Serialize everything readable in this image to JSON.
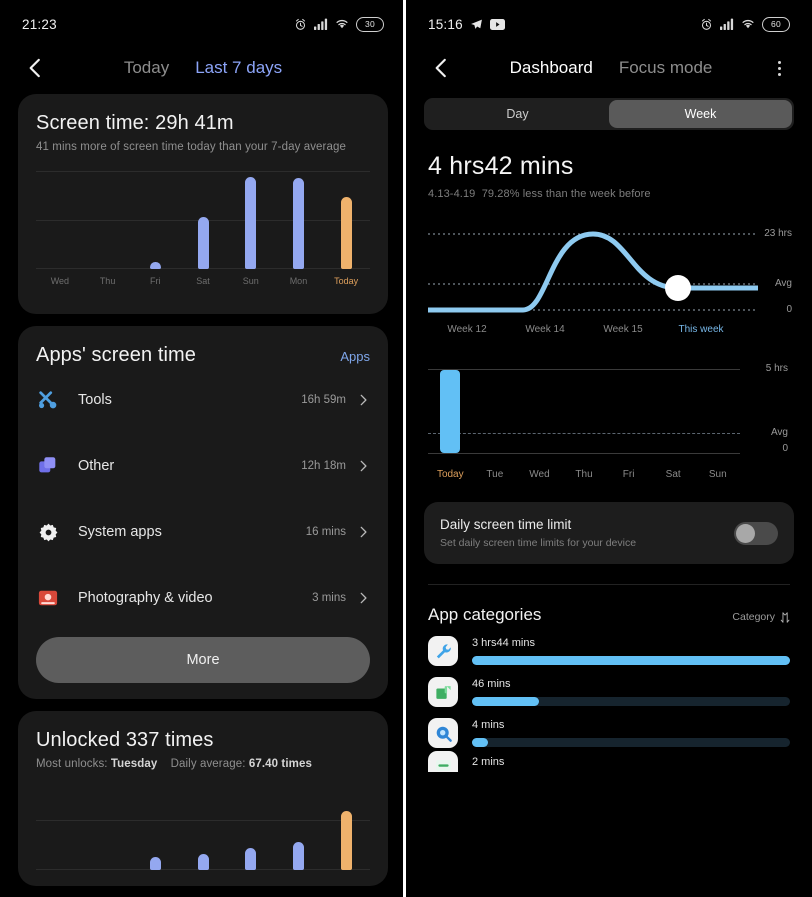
{
  "left": {
    "statusbar": {
      "time": "21:23",
      "battery": "30",
      "alarm_icon": "alarm-icon",
      "signal_icon": "signal-icon",
      "wifi_icon": "wifi-icon"
    },
    "nav": {
      "back_icon": "back-chevron-icon",
      "tab_today": "Today",
      "tab_last7": "Last 7 days"
    },
    "screen_time": {
      "title": "Screen time: 29h 41m",
      "subtitle": "41 mins more of screen time today than your 7-day average"
    },
    "apps": {
      "title": "Apps' screen time",
      "link": "Apps",
      "more": "More",
      "items": [
        {
          "icon": "tools-icon",
          "name": "Tools",
          "time": "16h 59m"
        },
        {
          "icon": "other-icon",
          "name": "Other",
          "time": "12h 18m"
        },
        {
          "icon": "gear-icon",
          "name": "System apps",
          "time": "16 mins"
        },
        {
          "icon": "camera-icon",
          "name": "Photography & video",
          "time": "3 mins"
        }
      ]
    },
    "unlocked": {
      "title": "Unlocked 337 times",
      "most_label": "Most unlocks:",
      "most_value": "Tuesday",
      "avg_label": "Daily average:",
      "avg_value": "67.40 times"
    }
  },
  "right": {
    "statusbar": {
      "time": "15:16",
      "battery": "60",
      "telegram_icon": "telegram-icon",
      "youtube_icon": "youtube-icon",
      "alarm_icon": "alarm-icon",
      "signal_icon": "signal-icon",
      "wifi_icon": "wifi-icon"
    },
    "nav": {
      "back_icon": "back-chevron-icon",
      "tab_dashboard": "Dashboard",
      "tab_focus": "Focus mode",
      "menu_icon": "kebab-menu-icon"
    },
    "segmented": {
      "day": "Day",
      "week": "Week",
      "selected": "Week"
    },
    "summary": {
      "hours": "4 hrs42 mins",
      "range": "4.13-4.19",
      "comparison": "79.28% less than the week before"
    },
    "limit": {
      "title": "Daily screen time limit",
      "subtitle": "Set daily screen time limits for your device",
      "toggle_state": "off"
    },
    "categories": {
      "title": "App categories",
      "sort_label": "Category",
      "sort_icon": "sort-icon",
      "items": [
        {
          "icon": "wrench-icon",
          "value": "3 hrs44 mins",
          "pct": 100
        },
        {
          "icon": "green-app-icon",
          "value": "46 mins",
          "pct": 21
        },
        {
          "icon": "search-icon",
          "value": "4 mins",
          "pct": 5
        },
        {
          "icon": "message-icon",
          "value": "2 mins",
          "pct": 3
        }
      ]
    }
  },
  "chart_data": [
    {
      "type": "bar",
      "title": "Screen time: 29h 41m",
      "categories": [
        "Wed",
        "Thu",
        "Fri",
        "Sat",
        "Sun",
        "Mon",
        "Today"
      ],
      "values": [
        0,
        0,
        3,
        45,
        85,
        84,
        62
      ],
      "ylabel": "hours",
      "ylim": [
        0,
        100
      ],
      "grid": true,
      "colors": [
        "#94a8f0",
        "#94a8f0",
        "#94a8f0",
        "#94a8f0",
        "#94a8f0",
        "#94a8f0",
        "#efb26c"
      ],
      "highlight": "Today"
    },
    {
      "type": "bar",
      "title": "Unlocked 337 times",
      "categories": [
        "Wed",
        "Thu",
        "Fri",
        "Sat",
        "Sun",
        "Mon",
        "Today"
      ],
      "values": [
        0,
        0,
        12,
        15,
        22,
        28,
        58
      ],
      "ylabel": "times",
      "ylim": [
        0,
        70
      ],
      "grid": true,
      "colors": [
        "#94a8f0",
        "#94a8f0",
        "#94a8f0",
        "#94a8f0",
        "#94a8f0",
        "#94a8f0",
        "#efb26c"
      ],
      "highlight": "Today"
    },
    {
      "type": "line",
      "title": "4 hrs42 mins",
      "x": [
        "Week 12",
        "Week 14",
        "Week 15",
        "This week"
      ],
      "values": [
        0,
        0,
        23,
        4.7
      ],
      "ylabel": "hours",
      "ytick_labels": [
        "23 hrs",
        "Avg",
        "0"
      ],
      "ylim": [
        0,
        23
      ],
      "grid": true,
      "line_color": "#8ecaf0",
      "marker": {
        "x": "This week",
        "y": 4.7,
        "color": "#ffffff"
      }
    },
    {
      "type": "bar",
      "title": "Daily screen time this week",
      "categories": [
        "Today",
        "Tue",
        "Wed",
        "Thu",
        "Fri",
        "Sat",
        "Sun"
      ],
      "values": [
        4.7,
        0,
        0,
        0,
        0,
        0,
        0
      ],
      "ylabel": "hours",
      "ytick_labels": [
        "5 hrs",
        "Avg",
        "0"
      ],
      "ylim": [
        0,
        5
      ],
      "grid": true,
      "colors": [
        "#62c0f5"
      ],
      "highlight": "Today"
    },
    {
      "type": "bar",
      "title": "App categories",
      "categories": [
        "3 hrs44 mins",
        "46 mins",
        "4 mins",
        "2 mins"
      ],
      "values": [
        224,
        46,
        4,
        2
      ],
      "ylabel": "minutes",
      "orientation": "horizontal",
      "bar_color": "#62c0f5"
    }
  ]
}
